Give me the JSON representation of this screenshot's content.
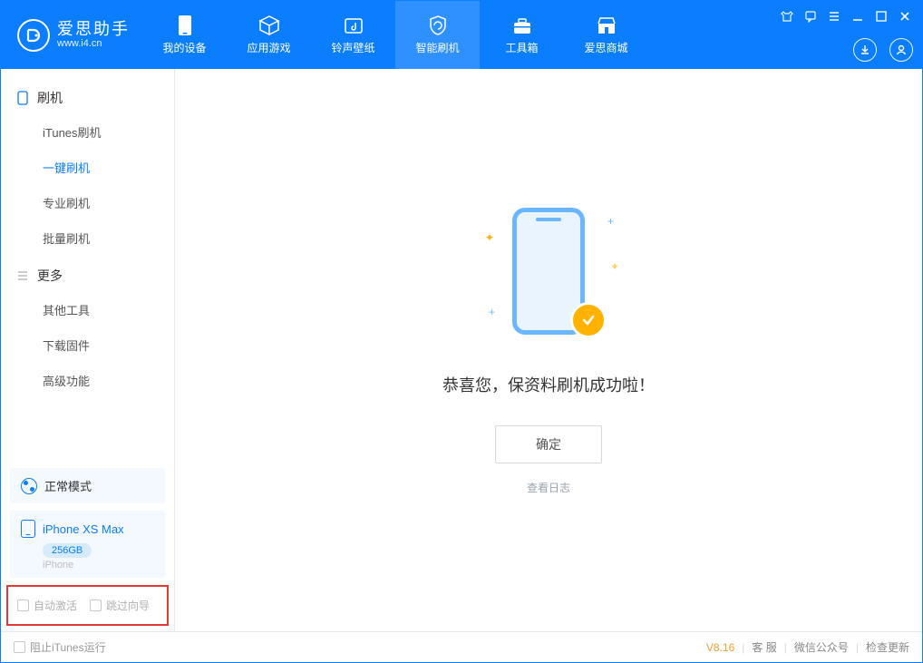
{
  "app": {
    "title": "爱思助手",
    "subtitle": "www.i4.cn"
  },
  "tabs": {
    "device": "我的设备",
    "apps": "应用游戏",
    "ringtones": "铃声壁纸",
    "flash": "智能刷机",
    "toolbox": "工具箱",
    "store": "爱思商城"
  },
  "sidebar": {
    "group_flash": "刷机",
    "items_flash": {
      "itunes": "iTunes刷机",
      "oneclick": "一键刷机",
      "pro": "专业刷机",
      "batch": "批量刷机"
    },
    "group_more": "更多",
    "items_more": {
      "other_tools": "其他工具",
      "download_fw": "下载固件",
      "advanced": "高级功能"
    },
    "mode": "正常模式",
    "device_name": "iPhone XS Max",
    "capacity": "256GB",
    "device_type": "iPhone",
    "cb_auto_activate": "自动激活",
    "cb_skip_wizard": "跳过向导"
  },
  "main": {
    "success_message": "恭喜您，保资料刷机成功啦！",
    "ok_button": "确定",
    "view_log": "查看日志"
  },
  "status": {
    "block_itunes": "阻止iTunes运行",
    "version": "V8.16",
    "link_service": "客 服",
    "link_wechat": "微信公众号",
    "link_update": "检查更新"
  }
}
